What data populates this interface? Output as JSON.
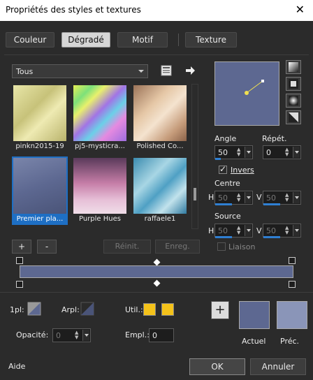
{
  "window": {
    "title": "Propriétés des styles et textures",
    "close_glyph": "✕"
  },
  "tabs": [
    {
      "label": "Couleur",
      "active": false
    },
    {
      "label": "Dégradé",
      "active": true
    },
    {
      "label": "Motif",
      "active": false
    },
    {
      "label": "Texture",
      "active": false
    }
  ],
  "gradient_filter": {
    "selected": "Tous"
  },
  "gradients": [
    {
      "label": "pinkn2015-19",
      "selected": false
    },
    {
      "label": "pj5-mysticra...",
      "selected": false
    },
    {
      "label": "Polished Co...",
      "selected": false
    },
    {
      "label": "Premier pla...",
      "selected": true
    },
    {
      "label": "Purple Hues",
      "selected": false
    },
    {
      "label": "raffaele1",
      "selected": false
    }
  ],
  "angle": {
    "label": "Angle",
    "value": "50"
  },
  "repeat": {
    "label": "Répét.",
    "value": "0"
  },
  "invert": {
    "label": "Invers",
    "checked": true
  },
  "center": {
    "label": "Centre",
    "h_label": "H",
    "h_value": "50",
    "v_label": "V",
    "v_value": "50"
  },
  "source": {
    "label": "Source",
    "h_label": "H",
    "h_value": "50",
    "v_label": "V",
    "v_value": "50"
  },
  "link": {
    "label": "Liaison",
    "checked": false
  },
  "grid_buttons": {
    "add": "+",
    "remove": "-",
    "reset": "Réinit.",
    "save": "Enreg."
  },
  "stops": {
    "first_label": "1pl:",
    "back_label": "Arpl:",
    "user_label": "Util.:",
    "opacity_label": "Opacité:",
    "opacity_value": "0",
    "location_label": "Empl.:",
    "location_value": "0"
  },
  "samples": {
    "add": "+",
    "current_label": "Actuel",
    "previous_label": "Préc."
  },
  "colors": {
    "gradient": "#5d6891",
    "previous": "#8a95b8",
    "user": "#f4c21a",
    "accent": "#2f7fd2"
  },
  "footer": {
    "help": "Aide",
    "ok": "OK",
    "cancel": "Annuler"
  }
}
